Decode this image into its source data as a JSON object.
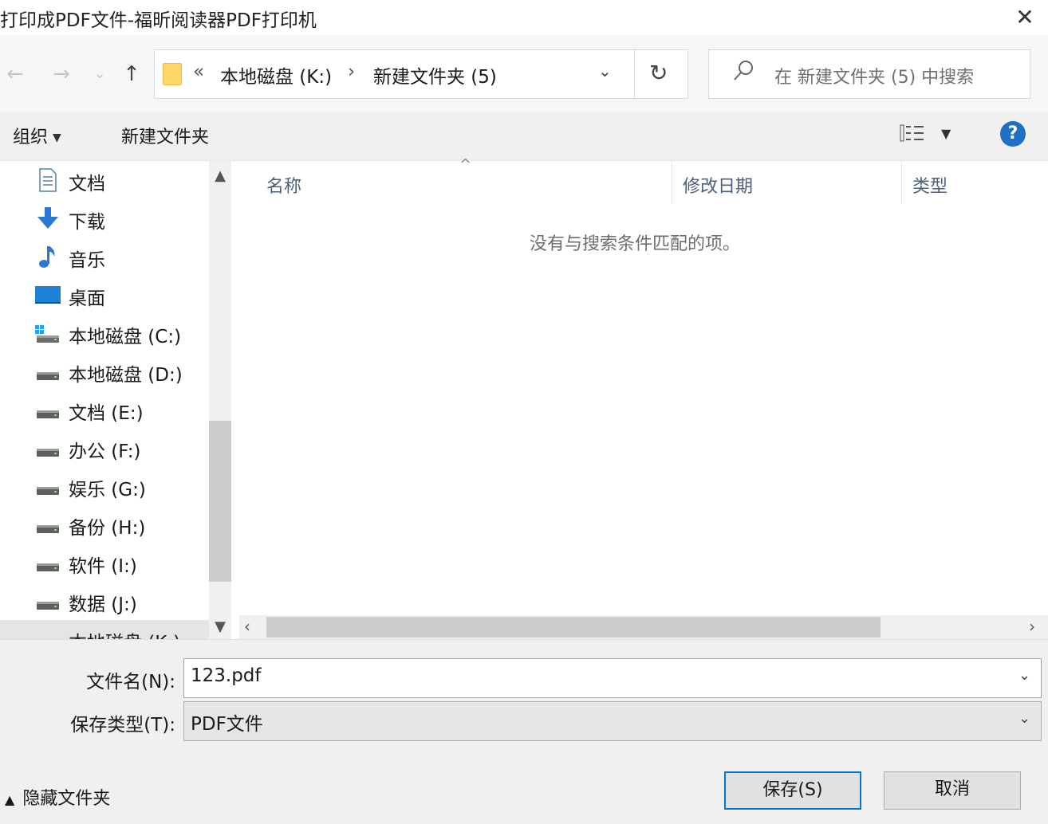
{
  "window": {
    "title": "打印成PDF文件-福昕阅读器PDF打印机",
    "close_glyph": "✕"
  },
  "nav": {
    "back_glyph": "←",
    "forward_glyph": "→",
    "recent_glyph": "⌄",
    "up_glyph": "↑"
  },
  "address": {
    "overflow": "«",
    "segments": [
      "本地磁盘 (K:)",
      "新建文件夹 (5)"
    ],
    "separator": "›",
    "dropdown_glyph": "⌄",
    "refresh_glyph": "↻"
  },
  "search": {
    "placeholder": "在 新建文件夹 (5) 中搜索",
    "icon": "search-icon"
  },
  "toolbar": {
    "organize_label": "组织",
    "new_folder_label": "新建文件夹",
    "help_label": "?"
  },
  "sidebar": {
    "items": [
      {
        "label": "文档",
        "icon": "document-icon"
      },
      {
        "label": "下载",
        "icon": "download-icon"
      },
      {
        "label": "音乐",
        "icon": "music-icon"
      },
      {
        "label": "桌面",
        "icon": "desktop-icon"
      },
      {
        "label": "本地磁盘 (C:)",
        "icon": "system-drive-icon"
      },
      {
        "label": "本地磁盘 (D:)",
        "icon": "drive-icon"
      },
      {
        "label": "文档 (E:)",
        "icon": "drive-icon"
      },
      {
        "label": "办公 (F:)",
        "icon": "drive-icon"
      },
      {
        "label": "娱乐 (G:)",
        "icon": "drive-icon"
      },
      {
        "label": "备份 (H:)",
        "icon": "drive-icon"
      },
      {
        "label": "软件 (I:)",
        "icon": "drive-icon"
      },
      {
        "label": "数据 (J:)",
        "icon": "drive-icon"
      },
      {
        "label": "本地磁盘 (K:)",
        "icon": "drive-icon"
      }
    ]
  },
  "file_list": {
    "columns": [
      "名称",
      "修改日期",
      "类型"
    ],
    "empty_message": "没有与搜索条件匹配的项。"
  },
  "form": {
    "filename_label": "文件名(N):",
    "filename_value": "123.pdf",
    "filetype_label": "保存类型(T):",
    "filetype_value": "PDF文件"
  },
  "footer": {
    "hide_folders_label": "隐藏文件夹",
    "save_label": "保存(S)",
    "cancel_label": "取消"
  },
  "colors": {
    "accent": "#0078d7",
    "help_blue": "#1f6fc5",
    "folder_yellow": "#ffd769"
  }
}
